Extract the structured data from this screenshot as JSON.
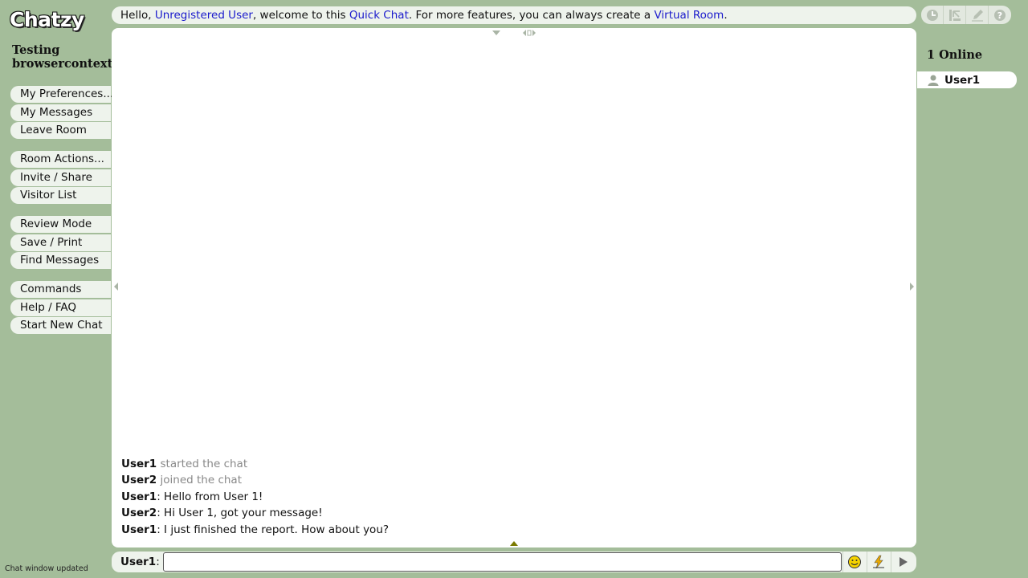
{
  "app": {
    "logo": "Chatzy",
    "room_title": "Testing browsercontexts"
  },
  "welcome": {
    "hello": "Hello, ",
    "user_link": "Unregistered User",
    "mid": ", welcome to this ",
    "quickchat_link": "Quick Chat",
    "mid2": ". For more features, you can always create a ",
    "virtualroom_link": "Virtual Room",
    "end": "."
  },
  "menu": {
    "group1": [
      "My Preferences...",
      "My Messages",
      "Leave Room"
    ],
    "group2": [
      "Room Actions...",
      "Invite / Share",
      "Visitor List"
    ],
    "group3": [
      "Review Mode",
      "Save / Print",
      "Find Messages"
    ],
    "group4": [
      "Commands",
      "Help / FAQ",
      "Start New Chat"
    ]
  },
  "tools": [
    "clock-icon",
    "layout-icon",
    "pencil-icon",
    "help-icon"
  ],
  "messages": [
    {
      "user": "User1",
      "text": " started the chat",
      "system": true
    },
    {
      "user": "User2",
      "text": " joined the chat",
      "system": true
    },
    {
      "user": "User1",
      "text": ": Hello from User 1!",
      "system": false
    },
    {
      "user": "User2",
      "text": ": Hi User 1, got your message!",
      "system": false
    },
    {
      "user": "User1",
      "text": ": I just finished the report. How about you?",
      "system": false
    }
  ],
  "online": {
    "title": "1 Online",
    "users": [
      "User1"
    ]
  },
  "input": {
    "user": "User1",
    "sep": ":",
    "value": ""
  },
  "status": "Chat window updated",
  "colors": {
    "background": "#a4bd9a",
    "panel": "#eef3ec",
    "link": "#1a1acc"
  }
}
